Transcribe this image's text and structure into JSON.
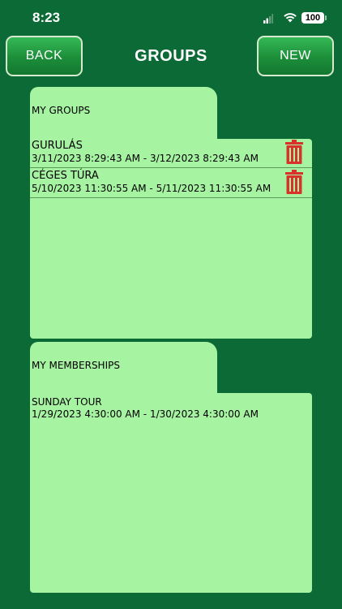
{
  "status_bar": {
    "time": "8:23",
    "battery": "100"
  },
  "header": {
    "back_label": "BACK",
    "title": "GROUPS",
    "new_label": "NEW"
  },
  "my_groups": {
    "title": "MY GROUPS",
    "items": [
      {
        "name": "GURULÁS",
        "dates": "3/11/2023 8:29:43 AM - 3/12/2023 8:29:43 AM"
      },
      {
        "name": "CÉGES TÚRA",
        "dates": "5/10/2023 11:30:55 AM - 5/11/2023 11:30:55 AM"
      }
    ]
  },
  "my_memberships": {
    "title": "MY MEMBERSHIPS",
    "items": [
      {
        "name": "SUNDAY TOUR",
        "dates": "1/29/2023 4:30:00 AM - 1/30/2023 4:30:00 AM"
      }
    ]
  },
  "colors": {
    "background": "#0b6a35",
    "panel": "#a6f3a2",
    "button_green": "#1c8e3a",
    "trash_red": "#d9322b"
  },
  "icons": {
    "delete": "trash-icon",
    "signal": "cellular-signal-icon",
    "wifi": "wifi-icon",
    "battery": "battery-icon"
  }
}
